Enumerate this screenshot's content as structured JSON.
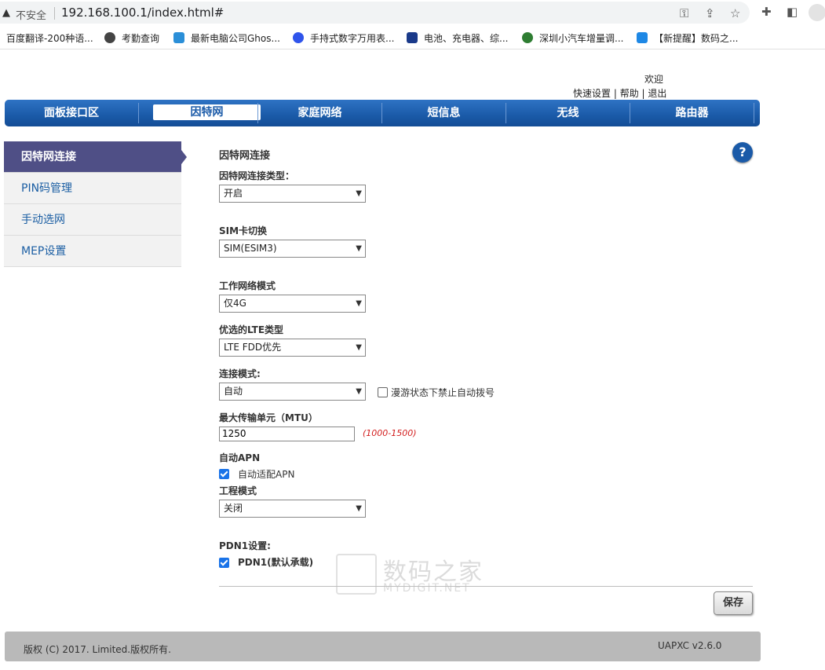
{
  "browser": {
    "security_label": "不安全",
    "url": "192.168.100.1/index.html#",
    "bookmarks": [
      {
        "label": "百度翻译-200种语...",
        "color": "#ffffff",
        "icon": "none"
      },
      {
        "label": "考勤查询",
        "color": "#333333",
        "icon": "globe-icon"
      },
      {
        "label": "最新电脑公司Ghos...",
        "color": "#2b8fd8",
        "icon": "bookmark-icon"
      },
      {
        "label": "手持式数字万用表...",
        "color": "#2f54eb",
        "icon": "paw-icon"
      },
      {
        "label": "电池、充电器、综...",
        "color": "#1a3a8a",
        "icon": "bookmark-icon"
      },
      {
        "label": "深圳小汽车增量调...",
        "color": "#2e7d32",
        "icon": "globe-icon"
      },
      {
        "label": "【新提醒】数码之...",
        "color": "#1e88e5",
        "icon": "home-icon"
      }
    ]
  },
  "header": {
    "welcome": "欢迎",
    "links": [
      "快速设置",
      "帮助",
      "退出"
    ],
    "link_separator": " | "
  },
  "nav": {
    "items": [
      "面板接口区",
      "因特网",
      "家庭网络",
      "短信息",
      "无线",
      "路由器"
    ],
    "active": "因特网"
  },
  "sidebar": {
    "items": [
      "因特网连接",
      "PIN码管理",
      "手动选网",
      "MEP设置"
    ],
    "active": "因特网连接"
  },
  "form": {
    "section_title": "因特网连接",
    "connection_type_label": "因特网连接类型：",
    "connection_type_value": "开启",
    "sim_switch_label": "SIM卡切换",
    "sim_switch_value": "SIM(ESIM3)",
    "network_mode_label": "工作网络模式",
    "network_mode_value": "仅4G",
    "lte_type_label": "优选的LTE类型",
    "lte_type_value": "LTE FDD优先",
    "connect_mode_label": "连接模式:",
    "connect_mode_value": "自动",
    "roaming_label": "漫游状态下禁止自动拨号",
    "roaming_checked": false,
    "mtu_label": "最大传输单元（MTU）",
    "mtu_value": "1250",
    "mtu_range": "(1000-1500)",
    "auto_apn_label": "自动APN",
    "auto_apn_check_label": "自动适配APN",
    "auto_apn_checked": true,
    "engineering_label": "工程模式",
    "engineering_value": "关闭",
    "pdn1_label": "PDN1设置:",
    "pdn1_check_label": "PDN1(默认承载)",
    "pdn1_checked": true,
    "save_label": "保存",
    "help_label": "?"
  },
  "footer": {
    "copyright": "版权 (C) 2017. Limited.版权所有.",
    "version": "UAPXC v2.6.0"
  },
  "watermark": {
    "cn": "数码之家",
    "en": "MYDIGIT.NET"
  },
  "colors": {
    "nav_blue": "#1a5aa8",
    "sidebar_active": "#4f4f86",
    "link_blue": "#1b5ea3",
    "range_red": "#d21d1d",
    "checkbox_blue": "#1a73e8"
  }
}
